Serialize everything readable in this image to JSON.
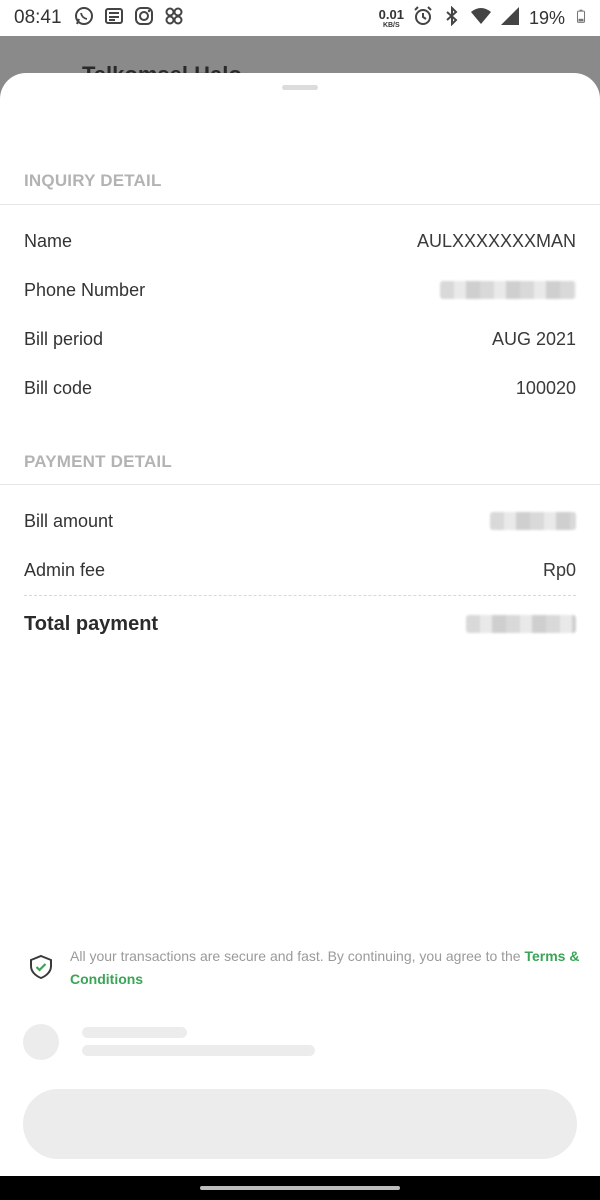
{
  "status_bar": {
    "time": "08:41",
    "net_speed_value": "0.01",
    "net_speed_unit": "KB/S",
    "battery": "19%",
    "left_icons": [
      "whatsapp-icon",
      "news-icon",
      "instagram-icon",
      "pinwheel-icon"
    ],
    "right_icons": [
      "alarm-icon",
      "bluetooth-icon",
      "wifi-icon",
      "signal-icon",
      "battery-icon"
    ]
  },
  "background_page": {
    "title": "Telkomsel Halo"
  },
  "inquiry": {
    "header": "INQUIRY DETAIL",
    "name_label": "Name",
    "name_value": "AULXXXXXXXMAN",
    "phone_label": "Phone Number",
    "period_label": "Bill period",
    "period_value": "AUG 2021",
    "code_label": "Bill code",
    "code_value": "100020"
  },
  "payment": {
    "header": "PAYMENT DETAIL",
    "amount_label": "Bill amount",
    "admin_label": "Admin fee",
    "admin_value": "Rp0",
    "total_label": "Total payment"
  },
  "footer": {
    "secure_text": "All your transactions are secure and fast. By continuing, you agree to the ",
    "terms_link": "Terms & Conditions"
  },
  "colors": {
    "accent_green": "#3aa556",
    "section_header": "#b3b3b3",
    "skeleton": "#ececec"
  }
}
